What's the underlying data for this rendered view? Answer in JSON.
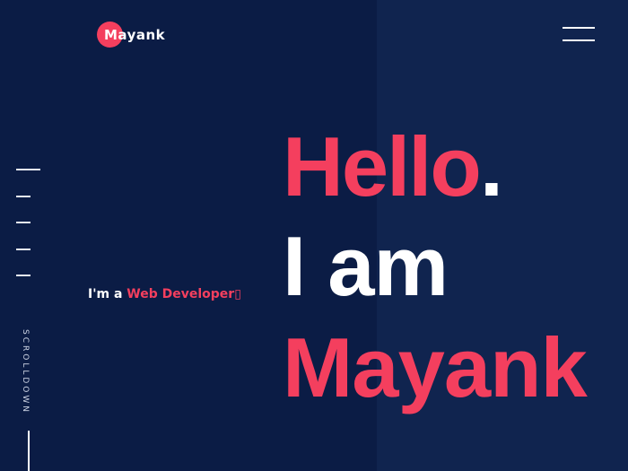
{
  "brand": {
    "initial": "M",
    "name": "Mayank",
    "accent_color": "#f43f5e"
  },
  "menu": {
    "icon": "hamburger-menu-icon"
  },
  "side_nav": {
    "count": 5
  },
  "scroll": {
    "label": "SCROLLDOWN"
  },
  "tagline": {
    "prefix": "I'm a ",
    "role": "Web Developer",
    "cursor": "▯"
  },
  "hero": {
    "line1": "Hello",
    "line1_period": ".",
    "line2": "I am",
    "line3": "Mayank"
  },
  "colors": {
    "background": "#0b1c45",
    "panel": "#10244f",
    "accent": "#f43f5e"
  }
}
